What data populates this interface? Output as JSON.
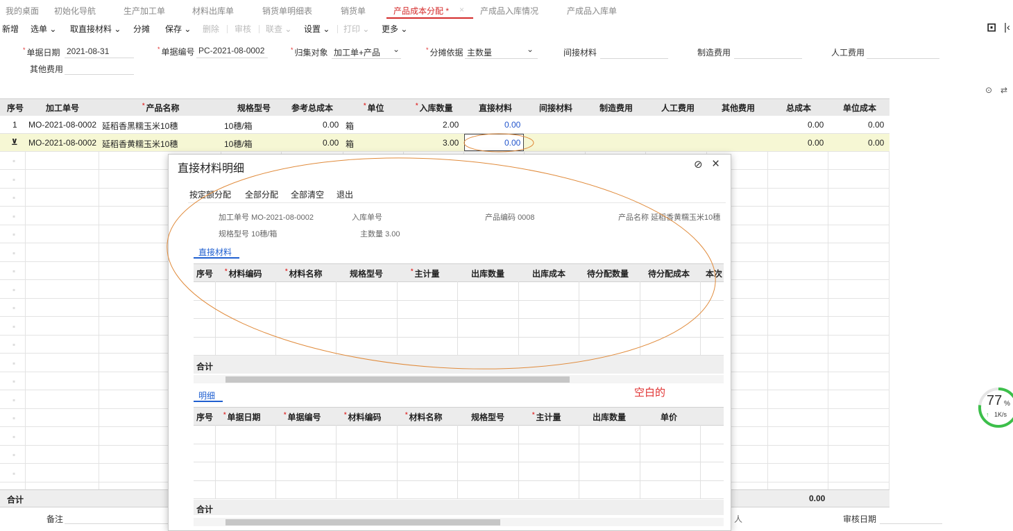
{
  "tabs": [
    {
      "label": "我的桌面"
    },
    {
      "label": "初始化导航"
    },
    {
      "label": "生产加工单"
    },
    {
      "label": "材料出库单"
    },
    {
      "label": "销货单明细表"
    },
    {
      "label": "销货单"
    },
    {
      "label": "产品成本分配 *"
    },
    {
      "label": "产成品入库情况"
    },
    {
      "label": "产成品入库单"
    }
  ],
  "toolbar": {
    "new": "新增",
    "select": "选单",
    "fetch_direct": "取直接材料",
    "allocate": "分摊",
    "save": "保存",
    "delete": "删除",
    "audit": "审核",
    "linked": "联查",
    "settings": "设置",
    "print": "打印",
    "more": "更多"
  },
  "form": {
    "date_label": "单据日期",
    "date_value": "2021-08-31",
    "doc_no_label": "单据编号",
    "doc_no_value": "PC-2021-08-0002",
    "collect_label": "归集对象",
    "collect_value": "加工单+产品",
    "basis_label": "分摊依据",
    "basis_value": "主数量",
    "indirect_label": "间接材料",
    "mfg_label": "制造费用",
    "labor_label": "人工费用",
    "other_label": "其他费用"
  },
  "grid": {
    "headers": [
      "序号",
      "加工单号",
      "产品名称",
      "规格型号",
      "参考总成本",
      "单位",
      "入库数量",
      "直接材料",
      "间接材料",
      "制造费用",
      "人工费用",
      "其他费用",
      "总成本",
      "单位成本"
    ],
    "rows": [
      {
        "no": "1",
        "order": "MO-2021-08-0002",
        "name": "延稻香黑糯玉米10穗",
        "spec": "10穗/箱",
        "ref_cost": "0.00",
        "unit": "箱",
        "qty": "2.00",
        "direct": "0.00",
        "total": "0.00",
        "unit_cost": "0.00"
      },
      {
        "no": "",
        "order": "MO-2021-08-0002",
        "name": "延稻香黄糯玉米10穗",
        "spec": "10穗/箱",
        "ref_cost": "0.00",
        "unit": "箱",
        "qty": "3.00",
        "direct": "0.00",
        "total": "0.00",
        "unit_cost": "0.00"
      }
    ],
    "sum_label": "合计",
    "sum_total": "0.00",
    "remark_label": "备注",
    "audit_date_label": "审核日期",
    "auditor_fragment": "人"
  },
  "modal": {
    "title": "直接材料明细",
    "actions": [
      "按定额分配",
      "全部分配",
      "全部清空",
      "退出"
    ],
    "order_label": "加工单号",
    "order_value": "MO-2021-08-0002",
    "instock_label": "入库单号",
    "code_label": "产品编码",
    "code_value": "0008",
    "name_label": "产品名称",
    "name_value": "延稻香黄糯玉米10穗",
    "spec_label": "规格型号",
    "spec_value": "10穗/箱",
    "qty_label": "主数量",
    "qty_value": "3.00",
    "tab1": "直接材料",
    "grid1_headers": [
      "序号",
      "材料编码",
      "材料名称",
      "规格型号",
      "主计量",
      "出库数量",
      "出库成本",
      "待分配数量",
      "待分配成本",
      "本次"
    ],
    "sum1": "合计",
    "tab2": "明细",
    "grid2_headers": [
      "序号",
      "单据日期",
      "单据编号",
      "材料编码",
      "材料名称",
      "规格型号",
      "主计量",
      "出库数量",
      "单价"
    ],
    "sum2": "合计"
  },
  "annotation": {
    "text": "空白的",
    "color": "#e03030",
    "ellipse_color": "#e08a3a"
  },
  "widget": {
    "percent": "77",
    "percent_unit": "%",
    "speed": "1K/s",
    "speed_arrow": "↑"
  }
}
